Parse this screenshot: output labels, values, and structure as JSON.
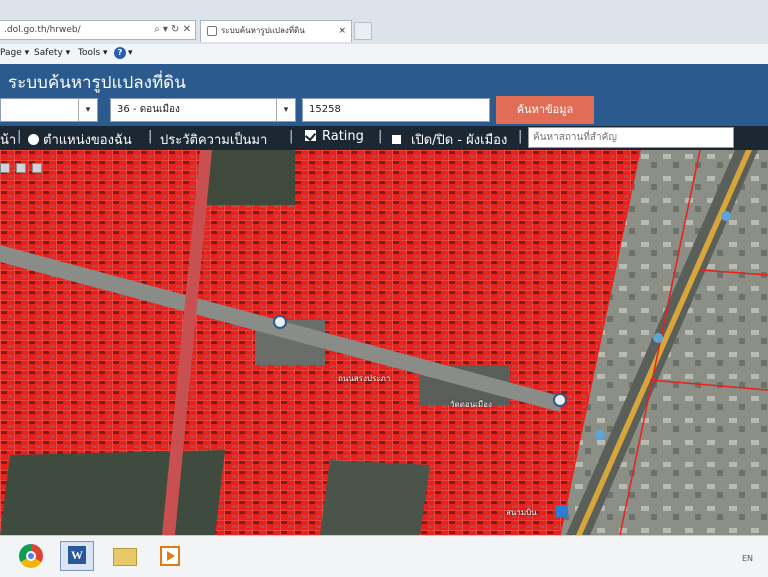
{
  "browser": {
    "address": ".dol.go.th/hrweb/",
    "address_controls": "⌕ ▾ ↻ ✕",
    "tab_title": "ระบบค้นหารูปแปลงที่ดิน",
    "tab_close": "×"
  },
  "menubar": {
    "page": "Page ▾",
    "safety": "Safety ▾",
    "tools": "Tools ▾",
    "help": "?",
    "help_caret": "▾"
  },
  "app": {
    "title": "ระบบค้นหารูปแปลงที่ดิน"
  },
  "search": {
    "province_value": "",
    "district_value": "36 - ดอนเมือง",
    "parcel_value": "15258",
    "caret": "▾",
    "button_label": "ค้นหาข้อมูล"
  },
  "toolbar": {
    "home_fragment": "น้า",
    "my_location": "ตำแหน่งของฉัน",
    "history": "ประวัติความเป็นมา",
    "rating": "Rating",
    "city_plan": "เปิด/ปิด - ผังเมือง",
    "separator": "|",
    "landmark_placeholder": "ค้นหาสถานที่สำคัญ"
  },
  "map_labels": {
    "label_1": "ถนนสรงประภา",
    "label_2": "วัดดอนเมือง",
    "label_3": "สนามบิน"
  },
  "taskbar": {
    "word_letter": "W",
    "language": "EN"
  },
  "colors": {
    "header_blue": "#2b5a8f",
    "toolbar_dark": "#1b2733",
    "search_button": "#e16d57",
    "parcel_red": "#e8211c"
  }
}
